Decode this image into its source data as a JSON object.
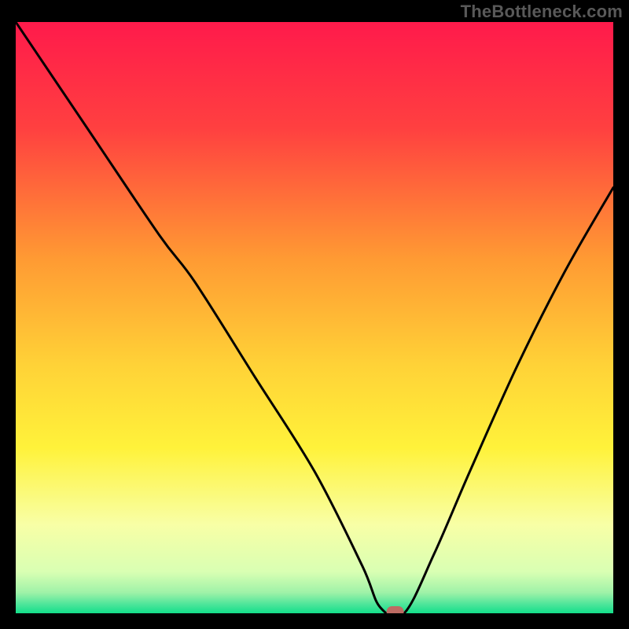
{
  "watermark": "TheBottleneck.com",
  "chart_data": {
    "type": "line",
    "title": "",
    "xlabel": "",
    "ylabel": "",
    "xlim": [
      0,
      100
    ],
    "ylim": [
      0,
      100
    ],
    "grid": false,
    "legend": false,
    "marker": {
      "x": 63.5,
      "y": 0,
      "color": "#bd6b63"
    },
    "series": [
      {
        "name": "curve",
        "x": [
          0,
          12,
          24,
          30,
          40,
          50,
          58,
          61,
          65,
          70,
          76,
          84,
          92,
          100
        ],
        "y": [
          100,
          82,
          64,
          56,
          40,
          24,
          8,
          1,
          0,
          10,
          24,
          42,
          58,
          72
        ]
      }
    ],
    "gradient_stops": [
      {
        "offset": 0,
        "color": "#ff1a4b"
      },
      {
        "offset": 0.18,
        "color": "#ff4040"
      },
      {
        "offset": 0.4,
        "color": "#ff9a33"
      },
      {
        "offset": 0.58,
        "color": "#ffd237"
      },
      {
        "offset": 0.72,
        "color": "#fff23a"
      },
      {
        "offset": 0.85,
        "color": "#f8ffa6"
      },
      {
        "offset": 0.93,
        "color": "#d9ffb3"
      },
      {
        "offset": 0.965,
        "color": "#9ff2a8"
      },
      {
        "offset": 0.985,
        "color": "#4de59a"
      },
      {
        "offset": 1.0,
        "color": "#13df8a"
      }
    ]
  }
}
